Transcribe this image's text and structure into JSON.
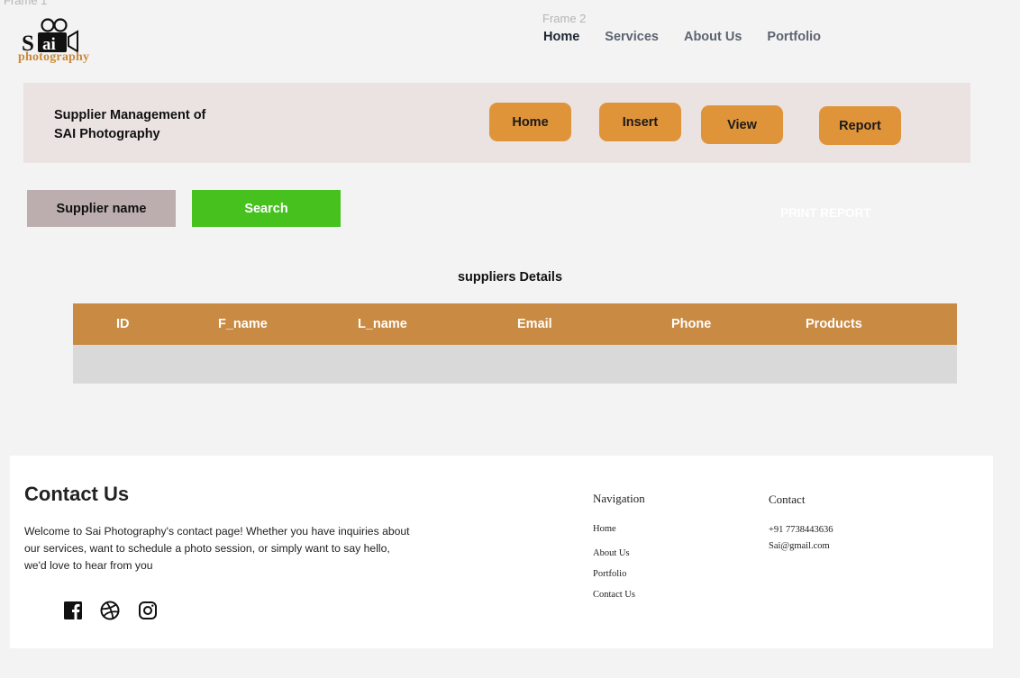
{
  "canvas": {
    "frame1_label": "Frame 1",
    "frame2_label": "Frame 2"
  },
  "brand": {
    "logo_text": "photography",
    "logo_letters": "Sai"
  },
  "topnav": {
    "items": [
      "Home",
      "Services",
      "About Us",
      "Portfolio"
    ],
    "active": "Home"
  },
  "header": {
    "title_line1": "Supplier Management of",
    "title_line2": "SAI Photography",
    "buttons": {
      "home": "Home",
      "insert": "Insert",
      "view": "View",
      "report": "Report"
    }
  },
  "search": {
    "field_label": "Supplier name",
    "button_label": "Search",
    "print_report": "PRINT REPORT"
  },
  "table": {
    "title": "suppliers Details",
    "columns": [
      "ID",
      "F_name",
      "L_name",
      "Email",
      "Phone",
      "Products"
    ],
    "rows": []
  },
  "footer": {
    "title": "Contact Us",
    "text": "Welcome to Sai Photography's contact page! Whether you have inquiries about our services, want to schedule a photo session, or simply want to say hello, we'd love to hear from you",
    "social": [
      "facebook-icon",
      "dribbble-icon",
      "instagram-icon"
    ],
    "navigation": {
      "title": "Navigation",
      "items": [
        "Home",
        "About Us",
        "Portfolio",
        "Contact Us"
      ]
    },
    "contact": {
      "title": "Contact",
      "phone": "+91 7738443636",
      "email": "Sai@gmail.com"
    }
  },
  "colors": {
    "accent": "#e0943a",
    "table_header": "#c98a43",
    "search": "#46c11e",
    "band": "#ebe2e2"
  }
}
